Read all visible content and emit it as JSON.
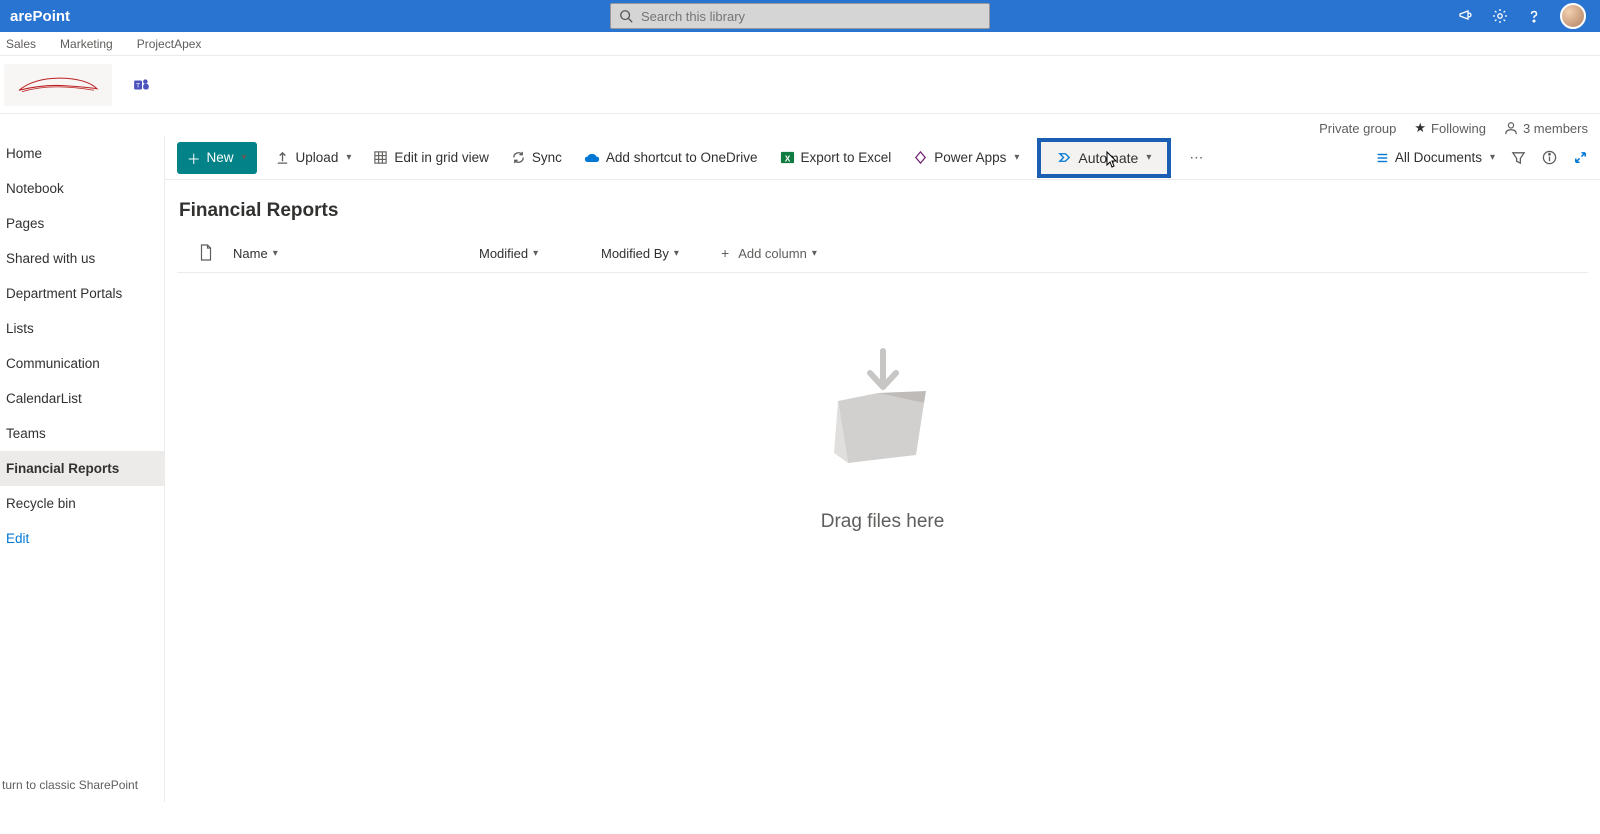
{
  "app": {
    "name": "arePoint"
  },
  "search": {
    "placeholder": "Search this library"
  },
  "hubTabs": [
    "Sales",
    "Marketing",
    "ProjectApex"
  ],
  "siteInfo": {
    "privacy": "Private group",
    "following": "Following",
    "members": "3 members"
  },
  "sidebar": {
    "items": [
      {
        "label": "Home",
        "active": false
      },
      {
        "label": "Notebook",
        "active": false
      },
      {
        "label": "Pages",
        "active": false
      },
      {
        "label": "Shared with us",
        "active": false
      },
      {
        "label": "Department Portals",
        "active": false
      },
      {
        "label": "Lists",
        "active": false
      },
      {
        "label": "Communication",
        "active": false
      },
      {
        "label": "CalendarList",
        "active": false
      },
      {
        "label": "Teams",
        "active": false
      },
      {
        "label": "Financial Reports",
        "active": true
      },
      {
        "label": "Recycle bin",
        "active": false
      }
    ],
    "edit": "Edit",
    "classic": "turn to classic SharePoint"
  },
  "commands": {
    "new": "New",
    "upload": "Upload",
    "gridview": "Edit in grid view",
    "sync": "Sync",
    "shortcut": "Add shortcut to OneDrive",
    "excel": "Export to Excel",
    "powerapps": "Power Apps",
    "automate": "Automate",
    "view": "All Documents"
  },
  "library": {
    "title": "Financial Reports",
    "columns": {
      "name": "Name",
      "modified": "Modified",
      "modifiedBy": "Modified By",
      "add": "Add column"
    },
    "emptyText": "Drag files here"
  }
}
